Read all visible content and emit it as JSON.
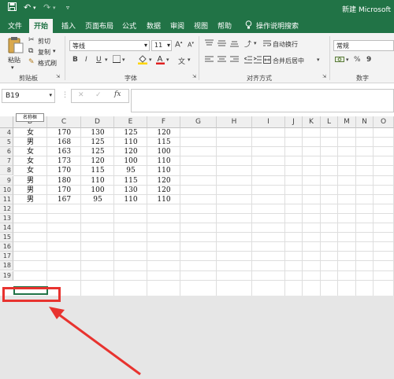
{
  "title_bar": {
    "app_title": "新建 Microsoft"
  },
  "quick_access": {
    "save_icon": "save-icon",
    "undo_icon": "undo-icon",
    "redo_icon": "redo-icon"
  },
  "tabs": [
    "文件",
    "开始",
    "插入",
    "页面布局",
    "公式",
    "数据",
    "审阅",
    "视图",
    "帮助"
  ],
  "active_tab": "开始",
  "tell_me": "操作说明搜索",
  "ribbon": {
    "clipboard": {
      "paste": "粘贴",
      "cut": "剪切",
      "copy": "复制",
      "format_painter": "格式刷",
      "label": "剪贴板"
    },
    "font": {
      "font_name": "等线",
      "font_size": "11",
      "grow": "A",
      "shrink": "A",
      "bold": "B",
      "italic": "I",
      "underline": "U",
      "wen": "文",
      "label": "字体"
    },
    "alignment": {
      "wrap_text": "自动换行",
      "merge_center": "合并后居中",
      "label": "对齐方式"
    },
    "number": {
      "format": "常规",
      "percent": "%",
      "comma": "9",
      "label": "数字"
    }
  },
  "formula_bar": {
    "name_box": "B19",
    "fx": "fx",
    "cancel": "✕",
    "enter": "✓"
  },
  "tooltip": "名称框",
  "grid": {
    "columns": [
      "B",
      "C",
      "D",
      "E",
      "F",
      "G",
      "H",
      "I",
      "J",
      "K",
      "L",
      "M",
      "N",
      "O"
    ],
    "row_numbers": [
      "4",
      "5",
      "6",
      "7",
      "8",
      "9",
      "10",
      "11",
      "12",
      "13",
      "14",
      "15",
      "16",
      "17",
      "18",
      "19"
    ],
    "rows": [
      [
        "女",
        "170",
        "130",
        "125",
        "120"
      ],
      [
        "男",
        "168",
        "125",
        "110",
        "115"
      ],
      [
        "女",
        "163",
        "125",
        "120",
        "100"
      ],
      [
        "女",
        "173",
        "120",
        "100",
        "110"
      ],
      [
        "女",
        "170",
        "115",
        "95",
        "110"
      ],
      [
        "男",
        "180",
        "110",
        "115",
        "120"
      ],
      [
        "男",
        "170",
        "100",
        "130",
        "120"
      ],
      [
        "男",
        "167",
        "95",
        "110",
        "110"
      ]
    ]
  },
  "colors": {
    "excel_green": "#217346",
    "highlight_red": "#e8332f"
  }
}
